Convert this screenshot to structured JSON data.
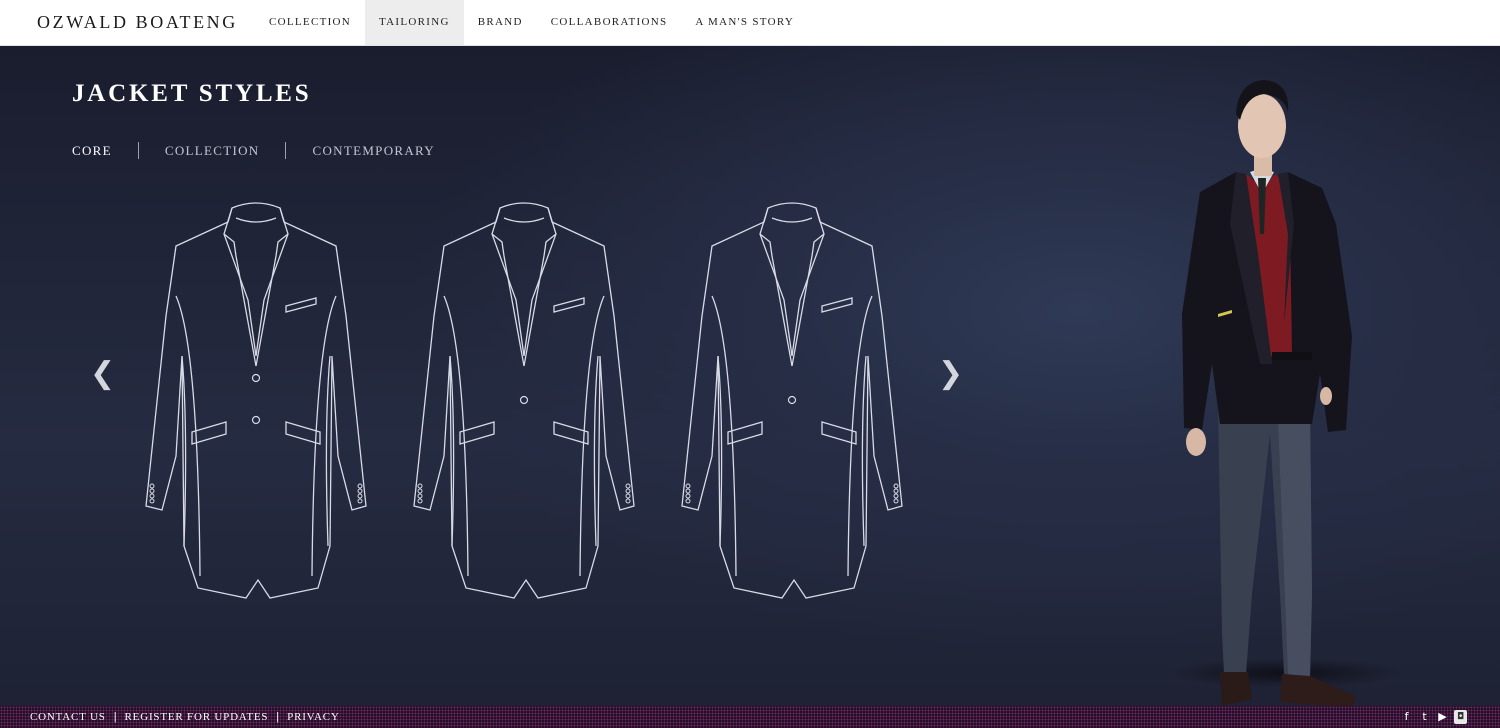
{
  "brand": {
    "logo_text": "OZWALD BOATENG"
  },
  "nav": {
    "items": [
      {
        "label": "COLLECTION",
        "active": false
      },
      {
        "label": "TAILORING",
        "active": true
      },
      {
        "label": "BRAND",
        "active": false
      },
      {
        "label": "COLLABORATIONS",
        "active": false
      },
      {
        "label": "A MAN'S STORY",
        "active": false
      }
    ]
  },
  "page": {
    "title": "JACKET STYLES",
    "tabs": [
      {
        "label": "CORE",
        "active": true
      },
      {
        "label": "COLLECTION",
        "active": false
      },
      {
        "label": "CONTEMPORARY",
        "active": false
      }
    ],
    "carousel": {
      "prev_glyph": "❮",
      "next_glyph": "❯",
      "jackets": [
        {
          "buttons": 2,
          "line_color": "#d8dbe6"
        },
        {
          "buttons": 1,
          "line_color": "#d8dbe6"
        },
        {
          "buttons": 1,
          "line_color": "#d8dbe6"
        }
      ]
    }
  },
  "footer": {
    "links": [
      "CONTACT US",
      "REGISTER FOR UPDATES",
      "PRIVACY"
    ],
    "separator": "|",
    "social": [
      {
        "icon": "facebook-icon",
        "glyph": "f"
      },
      {
        "icon": "twitter-icon",
        "glyph": "t"
      },
      {
        "icon": "youtube-icon",
        "glyph": "▶"
      },
      {
        "icon": "instagram-icon",
        "glyph": "◘"
      }
    ]
  },
  "colors": {
    "stage_background": "#1c2032",
    "footer_background": "#1b0d1c",
    "footer_pattern": "#6e2a6a",
    "sweater_red": "#8c1e25"
  }
}
